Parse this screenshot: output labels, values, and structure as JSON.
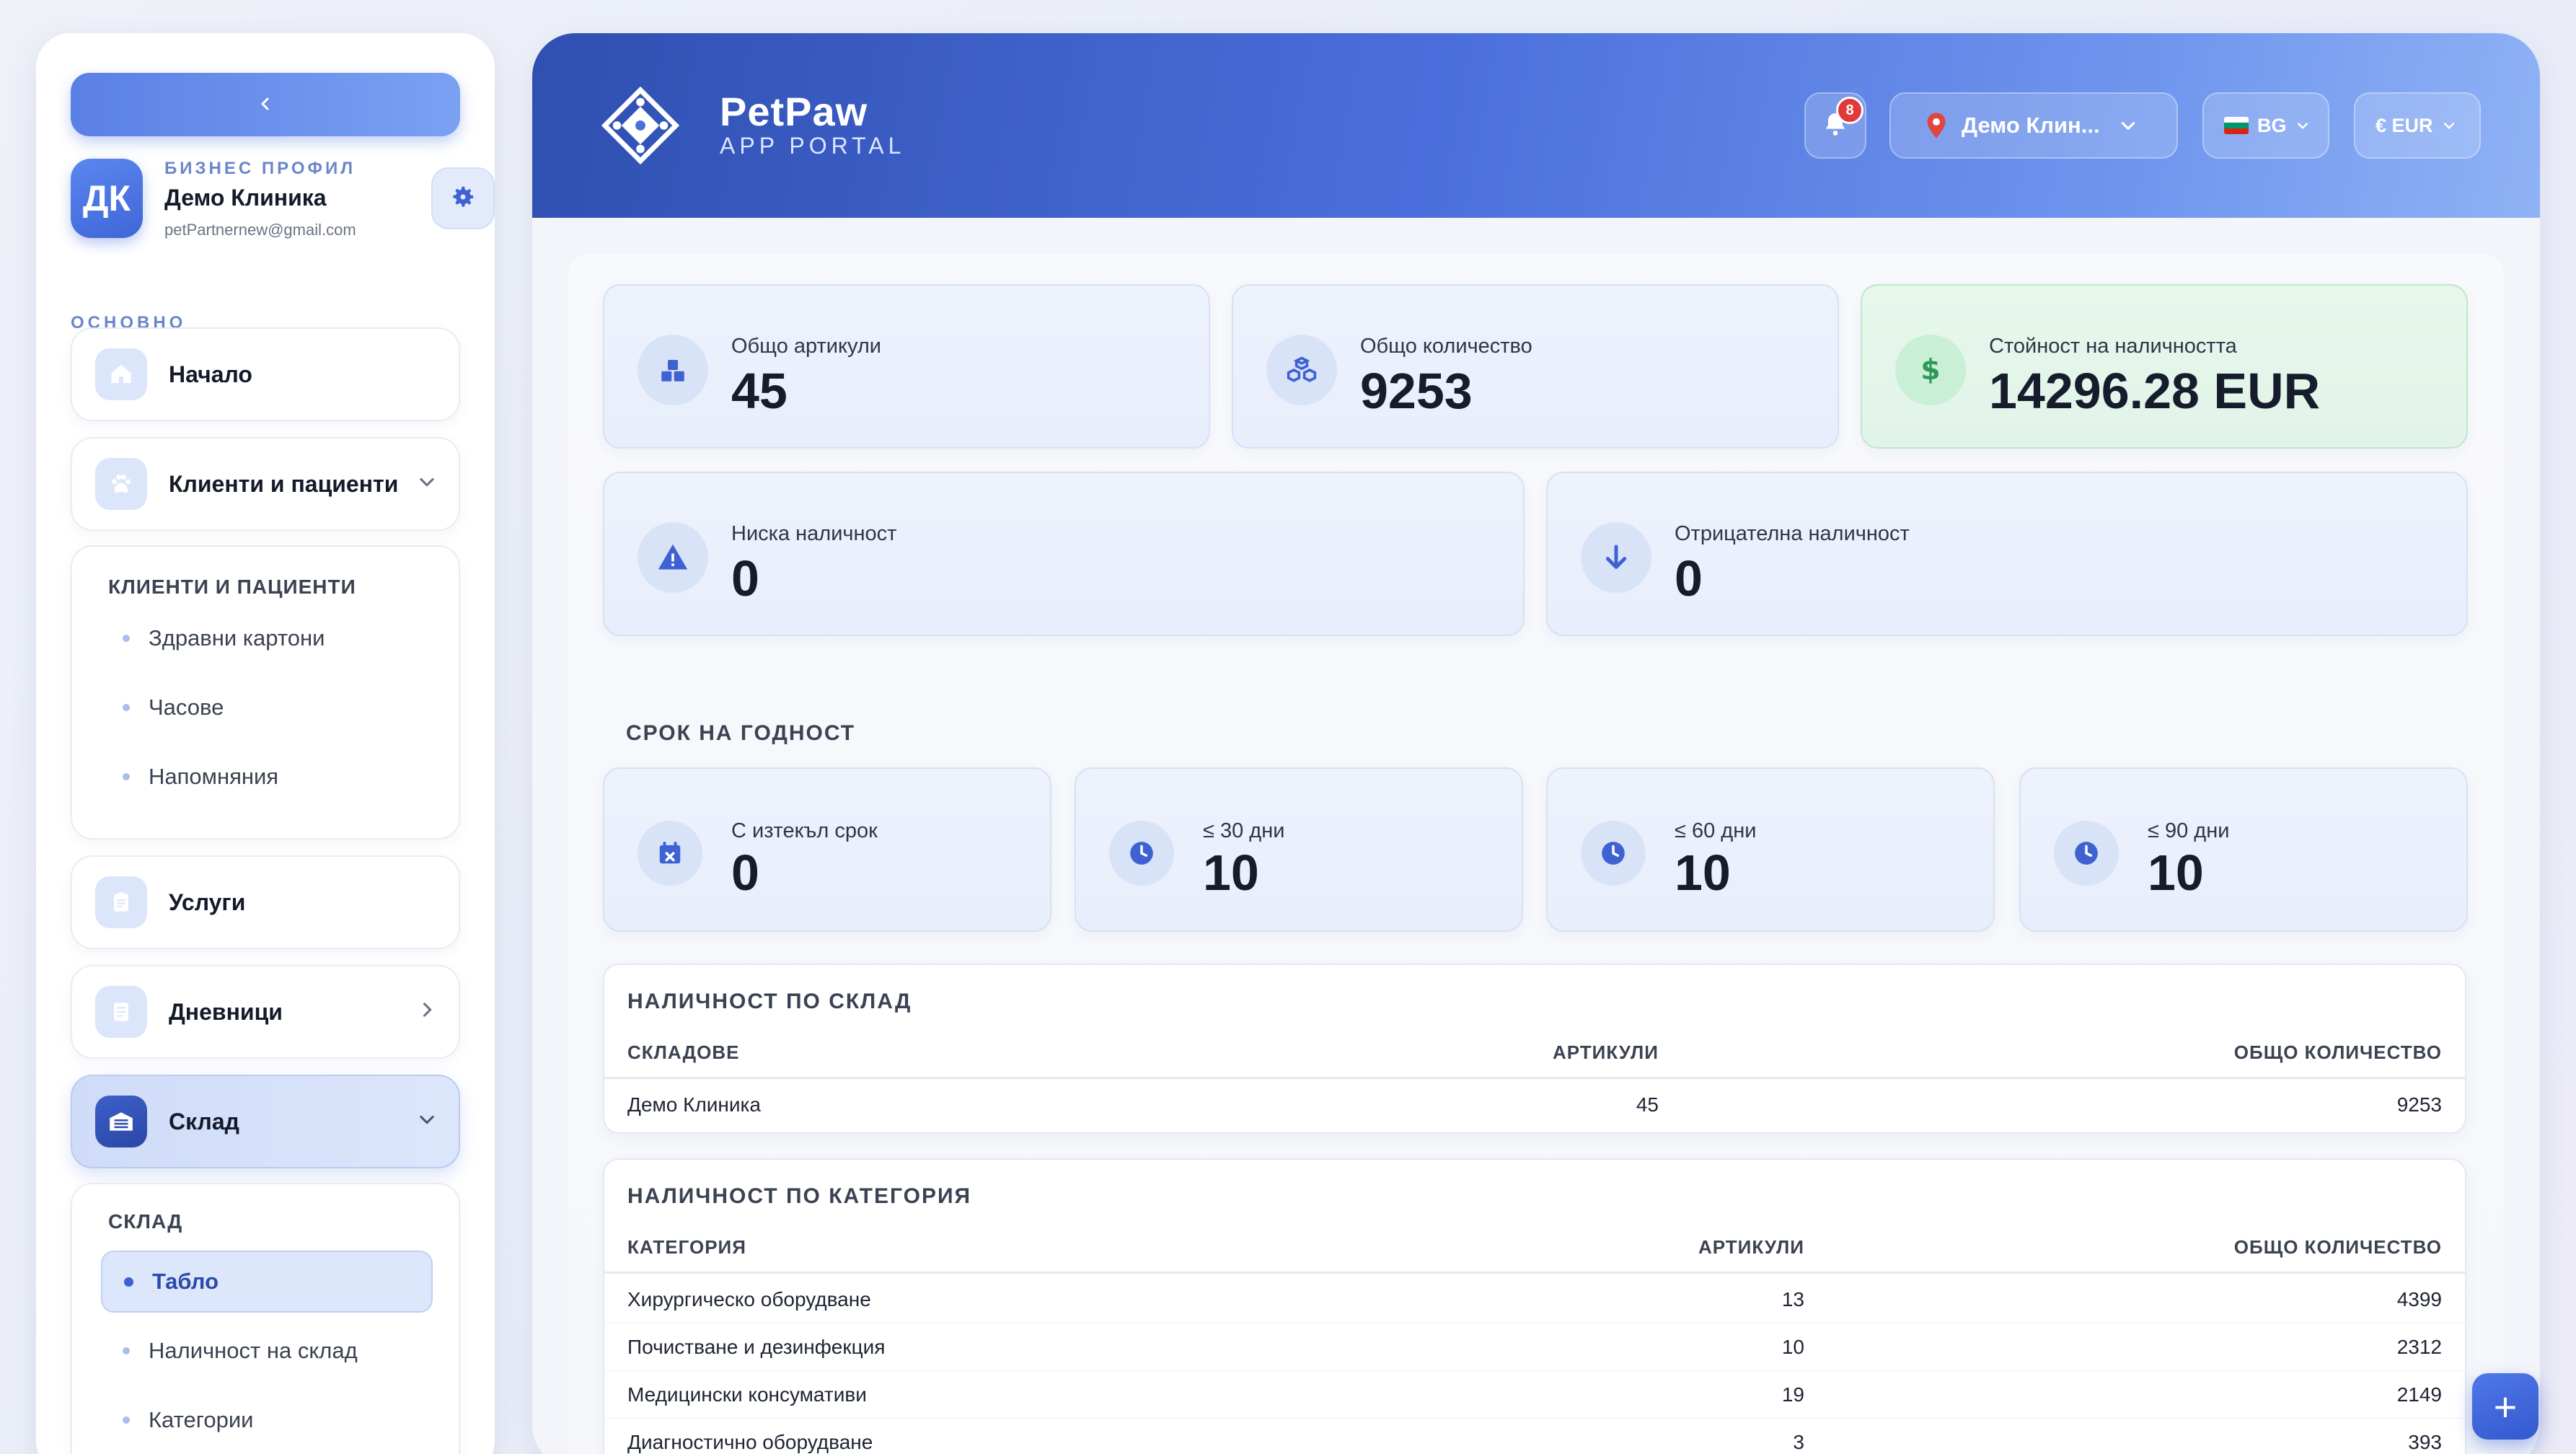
{
  "sidebar": {
    "collapse_label": "‹",
    "profile": {
      "initials": "ДК",
      "label": "БИЗНЕС ПРОФИЛ",
      "name": "Демо Клиника",
      "email": "petPartnernew@gmail.com"
    },
    "section_label": "ОСНОВНО",
    "items": {
      "home": "Начало",
      "clients": "Клиенти и пациенти",
      "services": "Услуги",
      "journals": "Дневници",
      "warehouse": "Склад"
    },
    "clients_panel": {
      "title": "КЛИЕНТИ И ПАЦИЕНТИ",
      "items": [
        "Здравни картони",
        "Часове",
        "Напомняния"
      ]
    },
    "warehouse_panel": {
      "title": "СКЛАД",
      "items": [
        "Табло",
        "Наличност на склад",
        "Категории"
      ]
    }
  },
  "header": {
    "brand": "PetPaw",
    "brand_sub": "APP PORTAL",
    "notifications_count": "8",
    "location": "Демо Клин...",
    "language": "BG",
    "currency": "€ EUR"
  },
  "stats": {
    "total_items": {
      "label": "Общо артикули",
      "value": "45"
    },
    "total_qty": {
      "label": "Общо количество",
      "value": "9253"
    },
    "stock_value": {
      "label": "Стойност на наличността",
      "value": "14296.28 EUR"
    },
    "low_stock": {
      "label": "Ниска наличност",
      "value": "0"
    },
    "negative_stock": {
      "label": "Отрицателна наличност",
      "value": "0"
    }
  },
  "expiry": {
    "title": "СРОК НА ГОДНОСТ",
    "expired": {
      "label": "С изтекъл срок",
      "value": "0"
    },
    "d30": {
      "label": "≤ 30 дни",
      "value": "10"
    },
    "d60": {
      "label": "≤ 60 дни",
      "value": "10"
    },
    "d90": {
      "label": "≤ 90 дни",
      "value": "10"
    }
  },
  "by_warehouse": {
    "title": "НАЛИЧНОСТ ПО СКЛАД",
    "columns": [
      "СКЛАДОВЕ",
      "АРТИКУЛИ",
      "ОБЩО КОЛИЧЕСТВО"
    ],
    "rows": [
      [
        "Демо Клиника",
        "45",
        "9253"
      ]
    ]
  },
  "by_category": {
    "title": "НАЛИЧНОСТ ПО КАТЕГОРИЯ",
    "columns": [
      "КАТЕГОРИЯ",
      "АРТИКУЛИ",
      "ОБЩО КОЛИЧЕСТВО"
    ],
    "rows": [
      [
        "Хирургическо оборудване",
        "13",
        "4399"
      ],
      [
        "Почистване и дезинфекция",
        "10",
        "2312"
      ],
      [
        "Медицински консумативи",
        "19",
        "2149"
      ],
      [
        "Диагностично оборудване",
        "3",
        "393"
      ]
    ]
  },
  "fab_label": "+",
  "colors": {
    "accent": "#4a6fdc",
    "header_start": "#2f4fb1",
    "header_end": "#8fb2f5",
    "success_bg": "#e6f7ec",
    "badge": "#e03a3a"
  },
  "icons": {
    "collapse": "chevron-left-icon",
    "settings": "gear-icon",
    "home": "home-icon",
    "clients": "paw-icon",
    "services": "clipboard-icon",
    "journals": "notebook-icon",
    "warehouse": "warehouse-icon",
    "notifications": "bell-icon",
    "location": "map-pin-icon",
    "stock_value": "dollar-icon",
    "low_stock": "warning-icon",
    "negative_stock": "arrow-down-icon",
    "expired": "calendar-x-icon",
    "expiry_window": "clock-icon"
  }
}
